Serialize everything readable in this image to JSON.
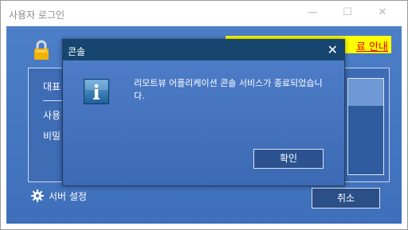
{
  "outer_window": {
    "title": "사용자 로그인",
    "notice_link": "료 안내",
    "panel_label_1": "대표",
    "panel_label_2": "사용",
    "panel_label_3": "비밀",
    "server_settings": "서버 설정",
    "cancel": "취소",
    "wm_minimize": "—",
    "wm_maximize": "☐",
    "wm_close": "✕"
  },
  "dialog": {
    "title": "콘솔",
    "close_glyph": "✕",
    "message": "리모트뷰 어플리케이션 콘솔 서비스가 종료되었습니다.",
    "ok": "확인"
  },
  "colors": {
    "window_blue": "#4c7fc8",
    "dialog_titlebar": "#16456f",
    "notice_yellow": "#ffff00",
    "notice_red": "#e00000"
  },
  "icons": [
    "lock-icon",
    "gear-icon",
    "info-icon",
    "close-icon"
  ]
}
